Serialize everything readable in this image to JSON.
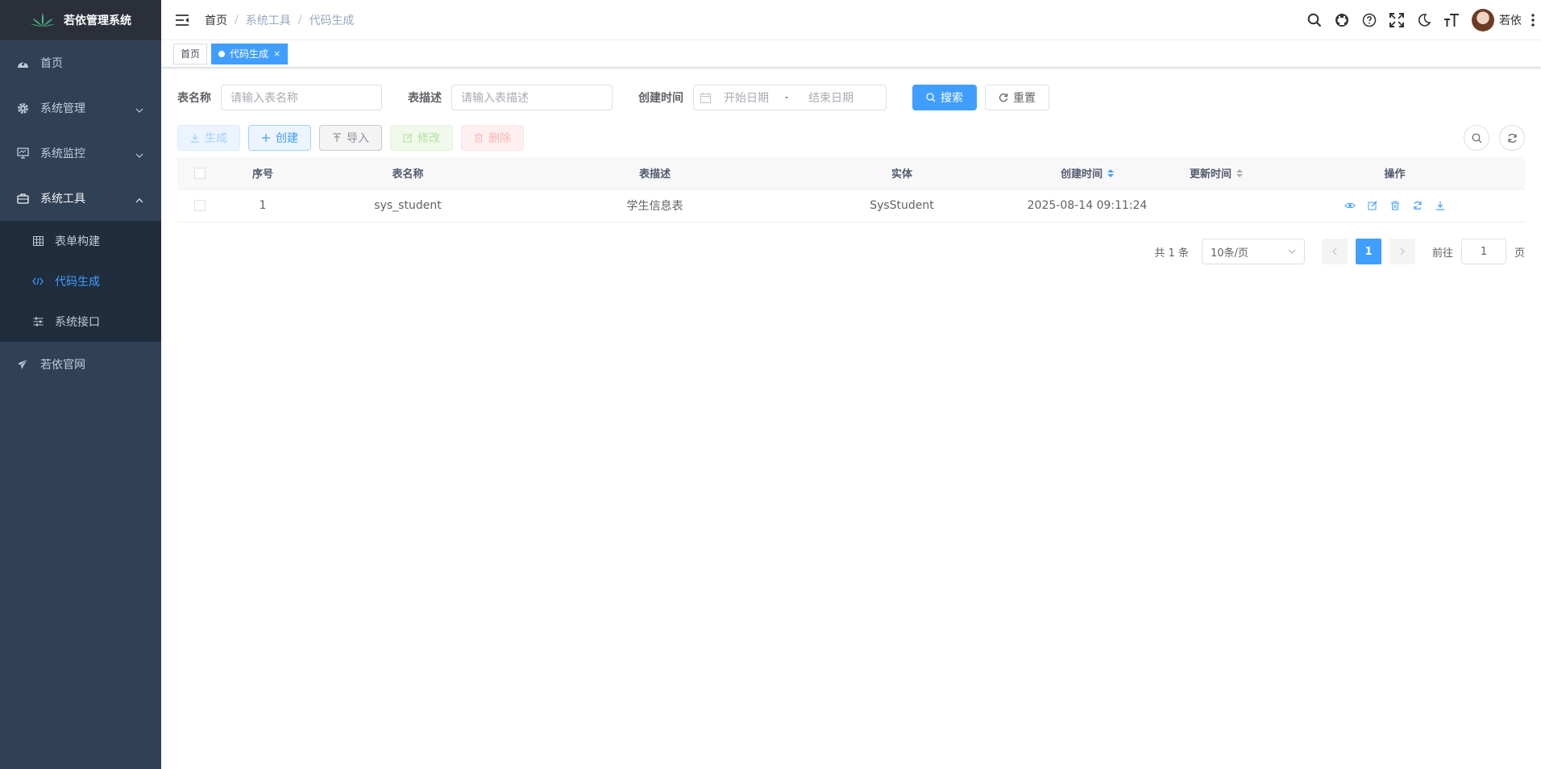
{
  "app": {
    "title": "若依管理系统"
  },
  "sidebar": {
    "items": [
      {
        "label": "首页"
      },
      {
        "label": "系统管理"
      },
      {
        "label": "系统监控"
      },
      {
        "label": "系统工具"
      },
      {
        "label": "若依官网"
      }
    ],
    "tool_sub": [
      {
        "label": "表单构建"
      },
      {
        "label": "代码生成"
      },
      {
        "label": "系统接口"
      }
    ]
  },
  "breadcrumb": [
    "首页",
    "系统工具",
    "代码生成"
  ],
  "user": {
    "name": "若依"
  },
  "tags": [
    {
      "label": "首页"
    },
    {
      "label": "代码生成",
      "close": "×"
    }
  ],
  "search": {
    "table_name_label": "表名称",
    "table_name_placeholder": "请输入表名称",
    "table_desc_label": "表描述",
    "table_desc_placeholder": "请输入表描述",
    "create_time_label": "创建时间",
    "start_placeholder": "开始日期",
    "range_sep": "-",
    "end_placeholder": "结束日期",
    "search_btn": "搜索",
    "reset_btn": "重置"
  },
  "toolbar": {
    "generate": "生成",
    "create": "创建",
    "import": "导入",
    "edit": "修改",
    "delete": "删除"
  },
  "table": {
    "columns": [
      "序号",
      "表名称",
      "表描述",
      "实体",
      "创建时间",
      "更新时间",
      "操作"
    ],
    "rows": [
      {
        "index": "1",
        "table_name": "sys_student",
        "table_desc": "学生信息表",
        "entity": "SysStudent",
        "create_time": "2025-08-14 09:11:24",
        "update_time": ""
      }
    ]
  },
  "pagination": {
    "total": "共 1 条",
    "page_size": "10条/页",
    "current": "1",
    "goto_label": "前往",
    "goto_value": "1",
    "page_suffix": "页"
  },
  "colors": {
    "primary": "#409eff",
    "sidebar": "#304156",
    "submenu": "#1f2d3d"
  }
}
